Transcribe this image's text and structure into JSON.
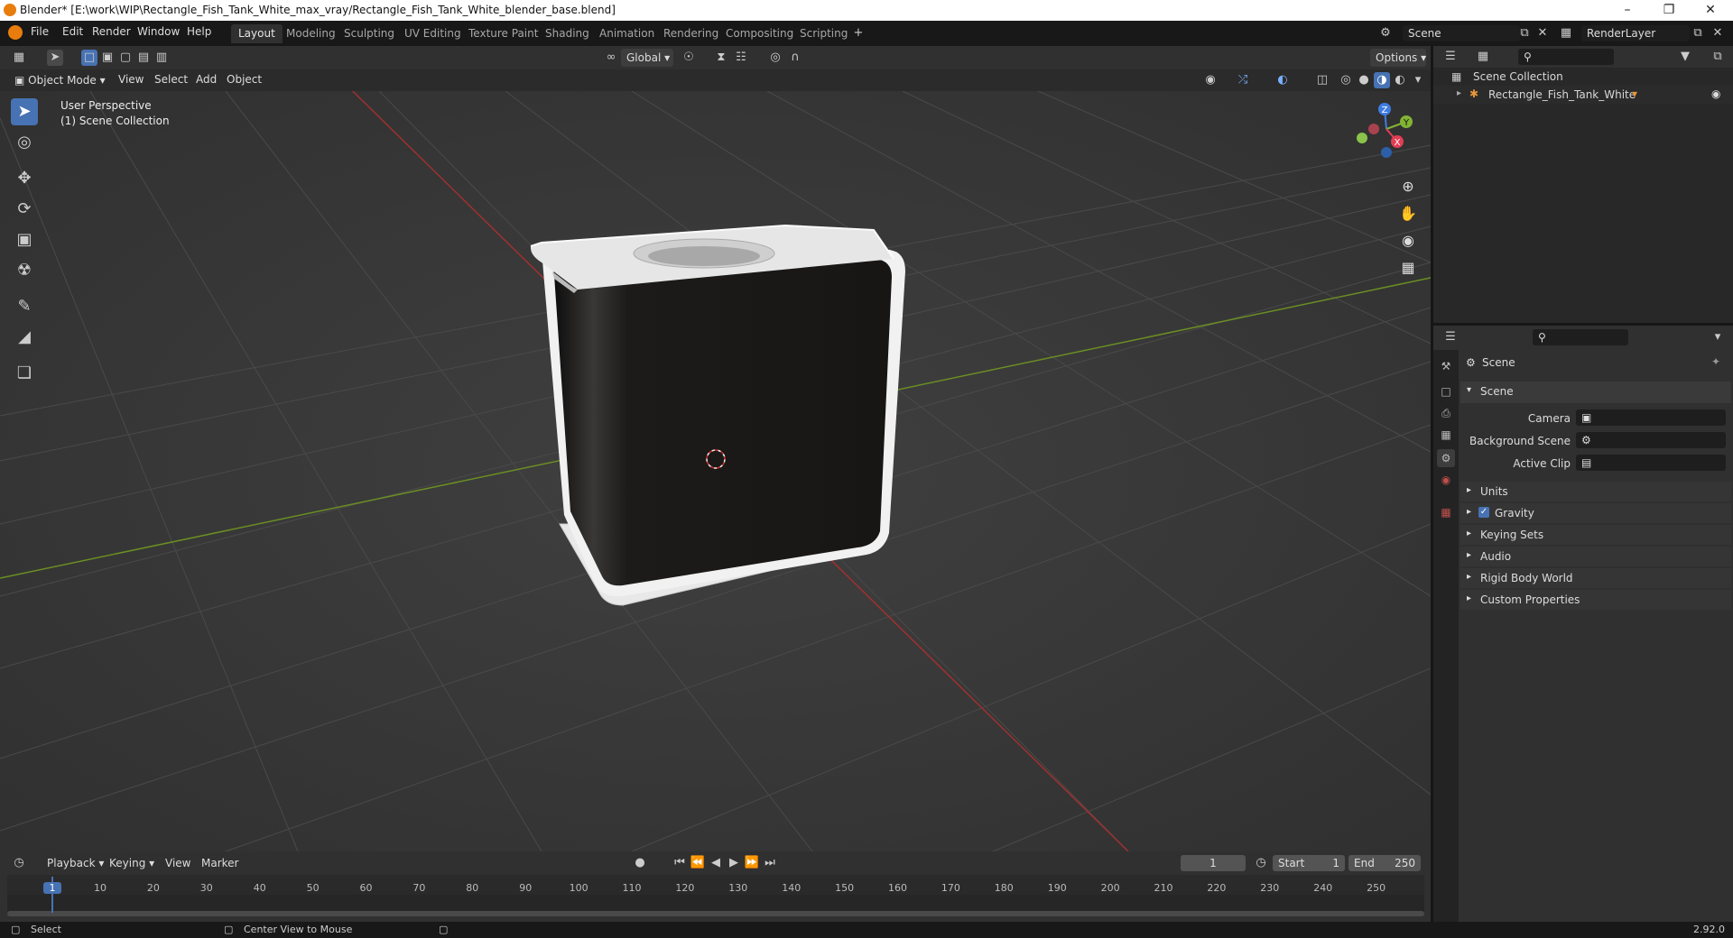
{
  "window": {
    "title": "Blender* [E:\\work\\WIP\\Rectangle_Fish_Tank_White_max_vray/Rectangle_Fish_Tank_White_blender_base.blend]"
  },
  "menus": [
    "File",
    "Edit",
    "Render",
    "Window",
    "Help"
  ],
  "workspaces": [
    "Layout",
    "Modeling",
    "Sculpting",
    "UV Editing",
    "Texture Paint",
    "Shading",
    "Animation",
    "Rendering",
    "Compositing",
    "Scripting"
  ],
  "scene_field": "Scene",
  "renderlayer_field": "RenderLayer",
  "viewport": {
    "transform_orientation": "Global",
    "options_label": "Options",
    "mode": "Object Mode",
    "header_menus": [
      "View",
      "Select",
      "Add",
      "Object"
    ],
    "info_line1": "User Perspective",
    "info_line2": "(1) Scene Collection",
    "gizmo_axes": {
      "x": "X",
      "y": "Y",
      "z": "Z"
    }
  },
  "outliner": {
    "root": "Scene Collection",
    "items": [
      {
        "label": "Rectangle_Fish_Tank_White"
      }
    ]
  },
  "properties": {
    "context": "Scene",
    "panel_title": "Scene",
    "fields": [
      {
        "label": "Camera"
      },
      {
        "label": "Background Scene"
      },
      {
        "label": "Active Clip"
      }
    ],
    "panels": [
      "Units",
      "Gravity",
      "Keying Sets",
      "Audio",
      "Rigid Body World",
      "Custom Properties"
    ]
  },
  "timeline": {
    "menus": [
      "Playback",
      "Keying",
      "View",
      "Marker"
    ],
    "current_frame": "1",
    "start_label": "Start",
    "start": "1",
    "end_label": "End",
    "end": "250",
    "ticks": [
      "1",
      "10",
      "20",
      "30",
      "40",
      "50",
      "60",
      "70",
      "80",
      "90",
      "100",
      "110",
      "120",
      "130",
      "140",
      "150",
      "160",
      "170",
      "180",
      "190",
      "200",
      "210",
      "220",
      "230",
      "240",
      "250"
    ]
  },
  "statusbar": {
    "select": "Select",
    "center_view": "Center View to Mouse",
    "version": "2.92.0"
  }
}
